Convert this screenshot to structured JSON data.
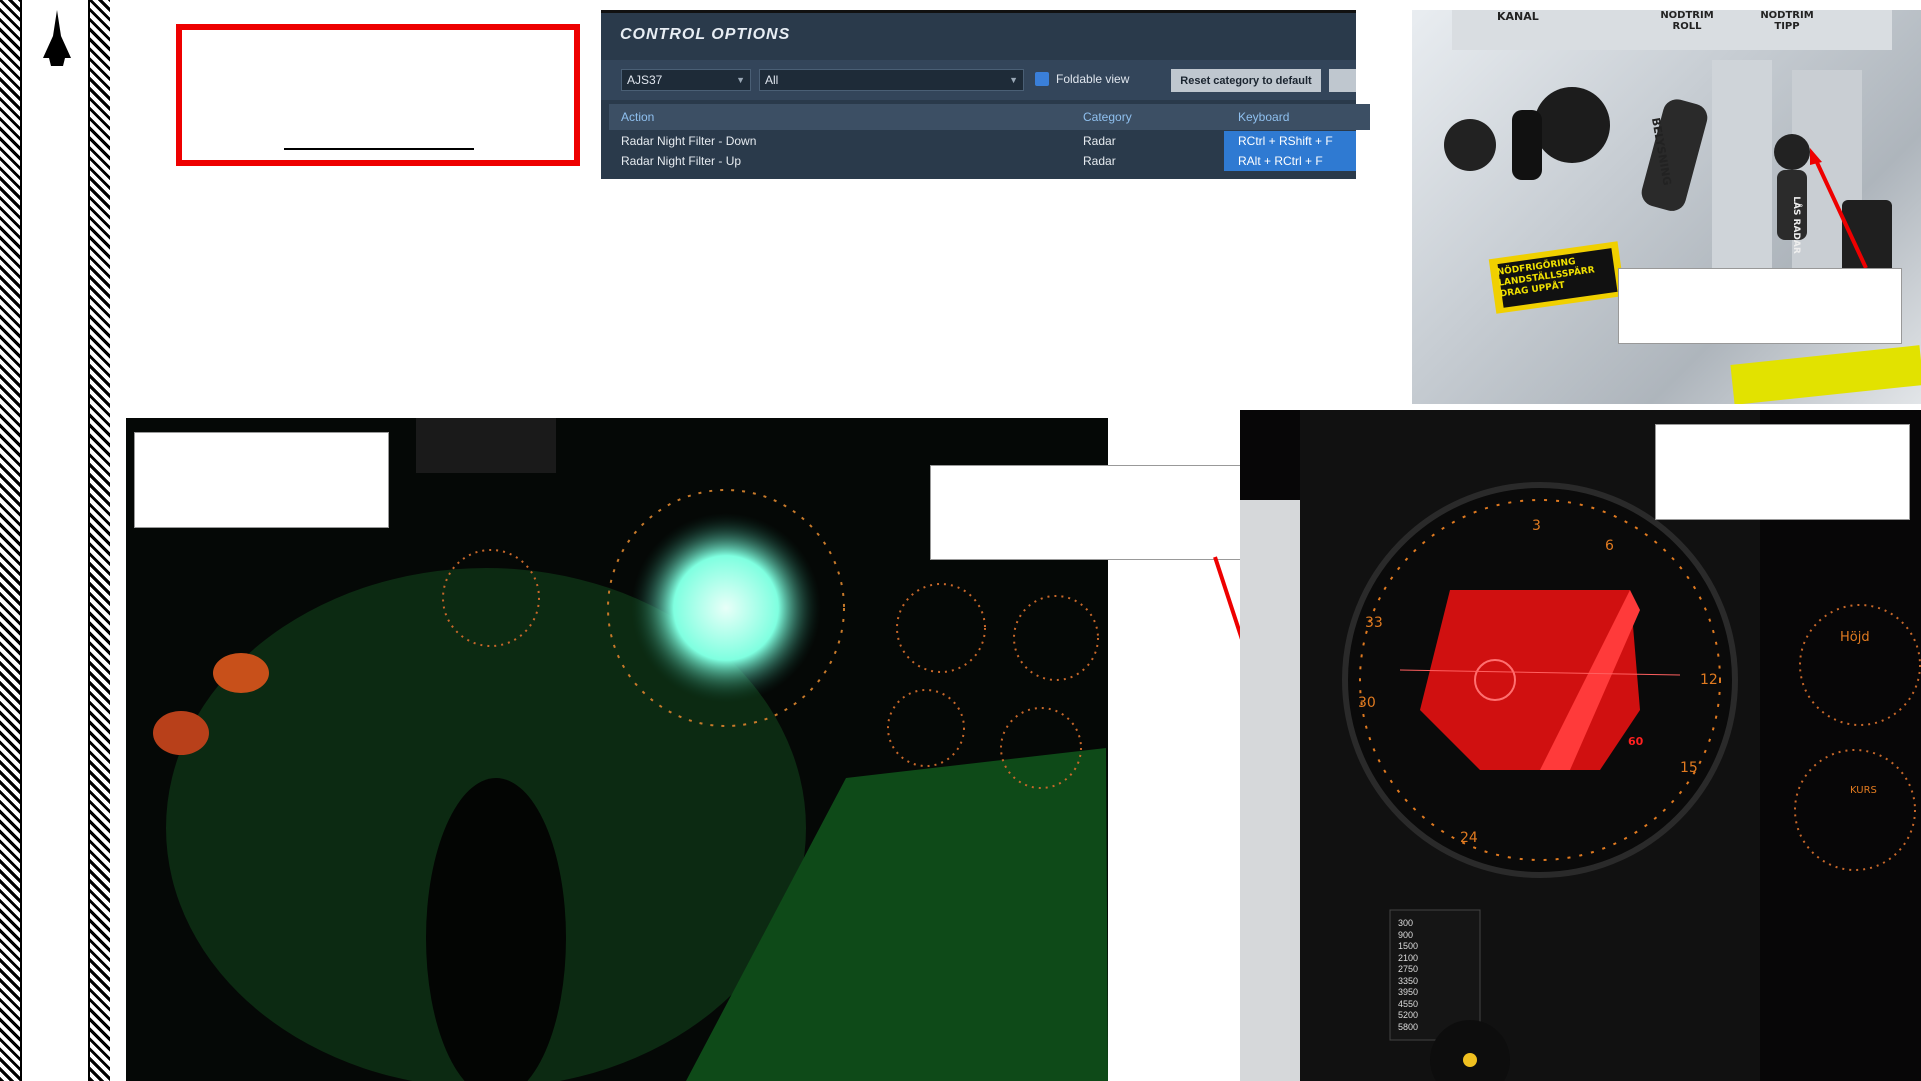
{
  "logo": {
    "icon": "aircraft-silhouette-icon"
  },
  "control_options": {
    "title": "CONTROL OPTIONS",
    "aircraft_select": "AJS37",
    "category_select": "All",
    "foldable_view_label": "Foldable view",
    "reset_button": "Reset category to default",
    "columns": {
      "action": "Action",
      "category": "Category",
      "keyboard": "Keyboard"
    },
    "rows": [
      {
        "action": "Radar Night Filter - Down",
        "category": "Radar",
        "keyboard": "RCtrl + RShift + F"
      },
      {
        "action": "Radar Night Filter - Up",
        "category": "Radar",
        "keyboard": "RAlt + RCtrl + F"
      }
    ]
  },
  "panel_photo": {
    "labels": [
      "KANAL",
      "NÖDTRIM ROLL",
      "NÖDTRIM TIPP",
      "BELYSNING",
      "LÅS RADAR",
      "NÖDFRIGÖRING LANDSTÄLLSSPÄRR DRAG UPPÅT"
    ]
  },
  "radar_photo": {
    "scale_labels": [
      "3",
      "6",
      "12",
      "15",
      "24",
      "30",
      "33"
    ],
    "range_marker": "60",
    "gauge_labels": [
      "Höjd",
      "KURS"
    ],
    "table_values": [
      "300",
      "900",
      "1500",
      "2100",
      "2750",
      "3350",
      "3950",
      "4550",
      "5200",
      "5800"
    ]
  },
  "colors": {
    "accent_red": "#ee0000",
    "panel_bg": "#2a3a4b",
    "key_highlight": "#2f7ad2",
    "radar_red": "#e01010",
    "scope_green": "#7fffe0"
  }
}
